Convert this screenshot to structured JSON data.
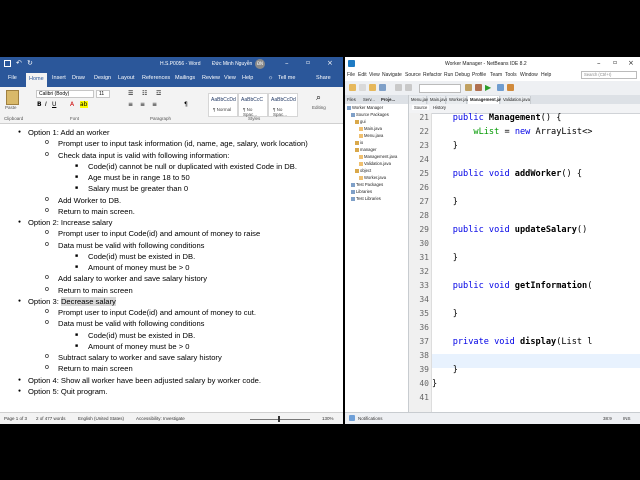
{
  "word": {
    "title": "H.S.P0056 - Word",
    "user": "Đức Minh Nguyễn",
    "user_initials": "ĐN",
    "tabs": [
      "File",
      "Home",
      "Insert",
      "Draw",
      "Design",
      "Layout",
      "References",
      "Mailings",
      "Review",
      "View",
      "Help",
      "Tell me",
      "Share"
    ],
    "active_tab": "Home",
    "ribbon": {
      "paste": "Paste",
      "clipboard": "Clipboard",
      "font_name": "Calibri (Body)",
      "font_size": "11",
      "font_group": "Font",
      "paragraph_group": "Paragraph",
      "styles_group": "Styles",
      "editing": "Editing",
      "styles": [
        {
          "sample": "AaBbCcDd",
          "name": "¶ Normal"
        },
        {
          "sample": "AaBbCcC",
          "name": "¶ No Spac..."
        },
        {
          "sample": "AaBbCcDd",
          "name": "¶ No Spac..."
        }
      ]
    },
    "doc_lines": [
      {
        "level": 1,
        "text": "Option  1: Add an worker"
      },
      {
        "level": 2,
        "text": "Prompt user to input task information (id, name, age, salary, work location)"
      },
      {
        "level": 2,
        "text": "Check data input is valid with following information:"
      },
      {
        "level": 3,
        "text": "Code(id) cannot be null or duplicated with existed Code in DB."
      },
      {
        "level": 3,
        "text": "Age must be in range 18 to 50"
      },
      {
        "level": 3,
        "text": "Salary must be greater than 0"
      },
      {
        "level": 2,
        "text": "Add Worker to DB."
      },
      {
        "level": 2,
        "text": "Return to main screen."
      },
      {
        "level": 1,
        "text": "Option  2: Increase salary"
      },
      {
        "level": 2,
        "text": "Prompt user to input Code(id) and amount of money to raise"
      },
      {
        "level": 2,
        "text": "Data must be valid with following conditions"
      },
      {
        "level": 3,
        "text": "Code(id) must be existed in DB."
      },
      {
        "level": 3,
        "text": "Amount of money must be > 0"
      },
      {
        "level": 2,
        "text": "Add salary to worker and save salary history"
      },
      {
        "level": 2,
        "text": "Return to main screen"
      },
      {
        "level": 1,
        "text": "Option  3: ",
        "highlight": "Decrease salary"
      },
      {
        "level": 2,
        "text": "Prompt user to input Code(id) and amount of money to cut."
      },
      {
        "level": 2,
        "text": "Data must be valid with following conditions"
      },
      {
        "level": 3,
        "text": "Code(id) must be existed in DB."
      },
      {
        "level": 3,
        "text": "Amount of money must be > 0"
      },
      {
        "level": 2,
        "text": "Subtract salary to worker and save salary history"
      },
      {
        "level": 2,
        "text": "Return to main screen"
      },
      {
        "level": 1,
        "text": "Option 4: Show all worker have been adjusted salary by worker code."
      },
      {
        "level": 1,
        "text": "Option 5: Quit program."
      }
    ],
    "status": {
      "page": "Page 1 of 3",
      "words": "2 of 477 words",
      "language": "English (United States)",
      "accessibility": "Accessibility: Investigate",
      "zoom": "130%"
    }
  },
  "netbeans": {
    "title": "Worker Manager - NetBeans IDE 8.2",
    "search_placeholder": "Search (Ctrl+I)",
    "menu": [
      "File",
      "Edit",
      "View",
      "Navigate",
      "Source",
      "Refactor",
      "Run",
      "Debug",
      "Profile",
      "Team",
      "Tools",
      "Window",
      "Help"
    ],
    "left_tabs": [
      "Files",
      "Serv...",
      "Proje..."
    ],
    "tree": [
      {
        "indent": 0,
        "text": "Worker Manager"
      },
      {
        "indent": 1,
        "text": "Source Packages"
      },
      {
        "indent": 2,
        "text": "gui"
      },
      {
        "indent": 3,
        "text": "Main.java"
      },
      {
        "indent": 3,
        "text": "Menu.java"
      },
      {
        "indent": 2,
        "text": "io"
      },
      {
        "indent": 2,
        "text": "manager"
      },
      {
        "indent": 3,
        "text": "Management.java"
      },
      {
        "indent": 3,
        "text": "Validation.java"
      },
      {
        "indent": 2,
        "text": "object"
      },
      {
        "indent": 3,
        "text": "Worker.java"
      },
      {
        "indent": 1,
        "text": "Test Packages"
      },
      {
        "indent": 1,
        "text": "Libraries"
      },
      {
        "indent": 1,
        "text": "Test Libraries"
      }
    ],
    "editor_tabs": [
      "Menu.java",
      "Main.java",
      "Worker.java",
      "Management.java",
      "Validation.java"
    ],
    "active_editor_tab": "Management.java",
    "editor_toolbar": [
      "Source",
      "History"
    ],
    "code_lines": [
      {
        "n": "21",
        "parts": [
          [
            "    ",
            ""
          ],
          [
            "public ",
            "kw"
          ],
          [
            "Management",
            "fn"
          ],
          [
            "() {",
            ""
          ]
        ]
      },
      {
        "n": "22",
        "parts": [
          [
            "        ",
            ""
          ],
          [
            "wList",
            "fld"
          ],
          [
            " = ",
            ""
          ],
          [
            "new ",
            "kw"
          ],
          [
            "ArrayList<>",
            ""
          ]
        ]
      },
      {
        "n": "23",
        "parts": [
          [
            "    }",
            ""
          ]
        ]
      },
      {
        "n": "24",
        "parts": []
      },
      {
        "n": "25",
        "parts": [
          [
            "    ",
            ""
          ],
          [
            "public void ",
            "kw"
          ],
          [
            "addWorker",
            "fn"
          ],
          [
            "() {",
            ""
          ]
        ]
      },
      {
        "n": "26",
        "parts": []
      },
      {
        "n": "27",
        "parts": [
          [
            "    }",
            ""
          ]
        ]
      },
      {
        "n": "28",
        "parts": []
      },
      {
        "n": "29",
        "parts": [
          [
            "    ",
            ""
          ],
          [
            "public void ",
            "kw"
          ],
          [
            "updateSalary",
            "fn"
          ],
          [
            "()",
            ""
          ]
        ]
      },
      {
        "n": "30",
        "parts": []
      },
      {
        "n": "31",
        "parts": [
          [
            "    }",
            ""
          ]
        ]
      },
      {
        "n": "32",
        "parts": []
      },
      {
        "n": "33",
        "parts": [
          [
            "    ",
            ""
          ],
          [
            "public void ",
            "kw"
          ],
          [
            "getInformation",
            "fn"
          ],
          [
            "(",
            ""
          ]
        ]
      },
      {
        "n": "34",
        "parts": []
      },
      {
        "n": "35",
        "parts": [
          [
            "    }",
            ""
          ]
        ]
      },
      {
        "n": "36",
        "parts": []
      },
      {
        "n": "37",
        "parts": [
          [
            "    ",
            ""
          ],
          [
            "private void ",
            "kw"
          ],
          [
            "display",
            "fn"
          ],
          [
            "(List l",
            ""
          ]
        ]
      },
      {
        "n": "38",
        "parts": []
      },
      {
        "n": "39",
        "parts": [
          [
            "    }",
            ""
          ]
        ]
      },
      {
        "n": "40",
        "parts": [
          [
            "}",
            ""
          ]
        ]
      },
      {
        "n": "41",
        "parts": []
      }
    ],
    "status": {
      "notifications": "Notifications",
      "position": "38:9",
      "mode": "INS"
    }
  },
  "colors": {
    "word_blue": "#2b579a",
    "keyword": "#0000e6",
    "field": "#009900"
  }
}
